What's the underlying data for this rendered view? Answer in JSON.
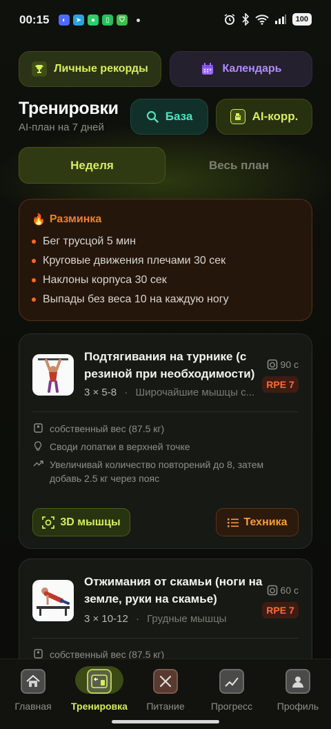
{
  "status_bar": {
    "time": "00:15",
    "battery": "100",
    "apps": [
      "messenger-app",
      "telegram-app",
      "chat-app",
      "phone-app",
      "vpn-app"
    ]
  },
  "header": {
    "records_label": "Личные рекорды",
    "calendar_label": "Календарь",
    "title": "Тренировки",
    "subtitle": "AI-план на 7 дней",
    "base_label": "База",
    "ai_label": "AI-корр."
  },
  "tabs": {
    "week": "Неделя",
    "full_plan": "Весь план"
  },
  "warmup": {
    "title": "Разминка",
    "items": [
      "Бег трусцой 5 мин",
      "Круговые движения плечами 30 сек",
      "Наклоны корпуса 30 сек",
      "Выпады без веса 10 на каждую ногу"
    ]
  },
  "exercises": [
    {
      "name": "Подтягивания на турнике (с резиной при необходимости)",
      "scheme": "3 × 5-8",
      "separator": "·",
      "muscle": "Широчайшие мышцы с...",
      "rest": "90 с",
      "rpe": "RPE 7",
      "weight": "собственный вес (87.5 кг)",
      "tip": "Своди лопатки в верхней точке",
      "progression": "Увеличивай количество повторений до 8, затем добавь 2.5 кг через пояс",
      "btn_3d": "3D мышцы",
      "btn_technique": "Техника"
    },
    {
      "name": "Отжимания от скамьи (ноги на земле, руки на скамье)",
      "scheme": "3 × 10-12",
      "separator": "·",
      "muscle": "Грудные мышцы",
      "rest": "60 с",
      "rpe": "RPE 7",
      "weight": "собственный вес (87.5 кг)"
    }
  ],
  "bottom_nav": [
    {
      "label": "Главная",
      "icon": "home-icon"
    },
    {
      "label": "Тренировка",
      "icon": "workout-icon",
      "active": true
    },
    {
      "label": "Питание",
      "icon": "nutrition-icon"
    },
    {
      "label": "Прогресс",
      "icon": "progress-icon"
    },
    {
      "label": "Профиль",
      "icon": "profile-icon"
    }
  ],
  "colors": {
    "accent_lime": "#d6ef5c",
    "accent_purple": "#b18bff",
    "accent_teal": "#4fe3c0",
    "accent_orange": "#ff7a2a",
    "background": "#0c0d0a"
  }
}
